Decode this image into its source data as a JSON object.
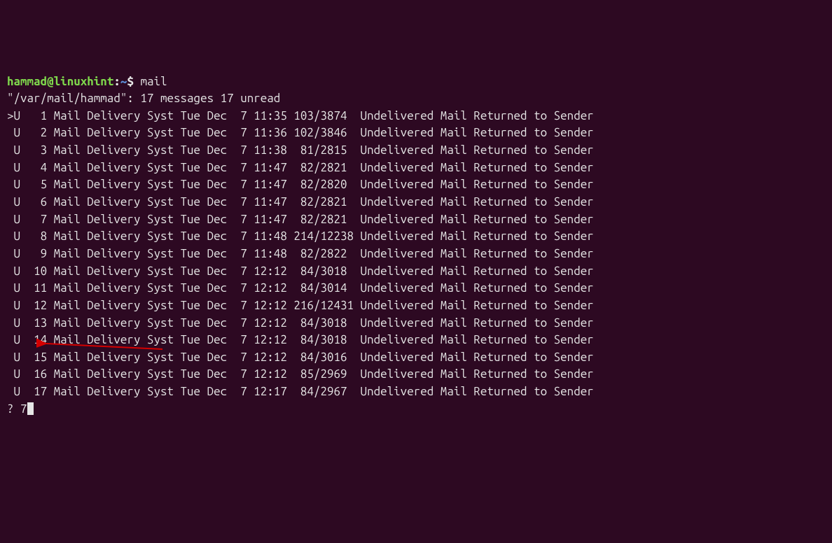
{
  "prompt": {
    "user": "hammad",
    "at": "@",
    "host": "linuxhint",
    "colon": ":",
    "tilde": "~",
    "dollar": "$",
    "command": "mail"
  },
  "header": "\"/var/mail/hammad\": 17 messages 17 unread",
  "messages": [
    {
      "cursor": ">",
      "flag": "U",
      "idx": " 1",
      "from": "Mail Delivery Syst",
      "date": "Tue Dec  7 11:35",
      "size": "103/3874 ",
      "subject": "Undelivered Mail Returned to Sender"
    },
    {
      "cursor": " ",
      "flag": "U",
      "idx": " 2",
      "from": "Mail Delivery Syst",
      "date": "Tue Dec  7 11:36",
      "size": "102/3846 ",
      "subject": "Undelivered Mail Returned to Sender"
    },
    {
      "cursor": " ",
      "flag": "U",
      "idx": " 3",
      "from": "Mail Delivery Syst",
      "date": "Tue Dec  7 11:38",
      "size": " 81/2815 ",
      "subject": "Undelivered Mail Returned to Sender"
    },
    {
      "cursor": " ",
      "flag": "U",
      "idx": " 4",
      "from": "Mail Delivery Syst",
      "date": "Tue Dec  7 11:47",
      "size": " 82/2821 ",
      "subject": "Undelivered Mail Returned to Sender"
    },
    {
      "cursor": " ",
      "flag": "U",
      "idx": " 5",
      "from": "Mail Delivery Syst",
      "date": "Tue Dec  7 11:47",
      "size": " 82/2820 ",
      "subject": "Undelivered Mail Returned to Sender"
    },
    {
      "cursor": " ",
      "flag": "U",
      "idx": " 6",
      "from": "Mail Delivery Syst",
      "date": "Tue Dec  7 11:47",
      "size": " 82/2821 ",
      "subject": "Undelivered Mail Returned to Sender"
    },
    {
      "cursor": " ",
      "flag": "U",
      "idx": " 7",
      "from": "Mail Delivery Syst",
      "date": "Tue Dec  7 11:47",
      "size": " 82/2821 ",
      "subject": "Undelivered Mail Returned to Sender"
    },
    {
      "cursor": " ",
      "flag": "U",
      "idx": " 8",
      "from": "Mail Delivery Syst",
      "date": "Tue Dec  7 11:48",
      "size": "214/12238",
      "subject": "Undelivered Mail Returned to Sender"
    },
    {
      "cursor": " ",
      "flag": "U",
      "idx": " 9",
      "from": "Mail Delivery Syst",
      "date": "Tue Dec  7 11:48",
      "size": " 82/2822 ",
      "subject": "Undelivered Mail Returned to Sender"
    },
    {
      "cursor": " ",
      "flag": "U",
      "idx": "10",
      "from": "Mail Delivery Syst",
      "date": "Tue Dec  7 12:12",
      "size": " 84/3018 ",
      "subject": "Undelivered Mail Returned to Sender"
    },
    {
      "cursor": " ",
      "flag": "U",
      "idx": "11",
      "from": "Mail Delivery Syst",
      "date": "Tue Dec  7 12:12",
      "size": " 84/3014 ",
      "subject": "Undelivered Mail Returned to Sender"
    },
    {
      "cursor": " ",
      "flag": "U",
      "idx": "12",
      "from": "Mail Delivery Syst",
      "date": "Tue Dec  7 12:12",
      "size": "216/12431",
      "subject": "Undelivered Mail Returned to Sender"
    },
    {
      "cursor": " ",
      "flag": "U",
      "idx": "13",
      "from": "Mail Delivery Syst",
      "date": "Tue Dec  7 12:12",
      "size": " 84/3018 ",
      "subject": "Undelivered Mail Returned to Sender"
    },
    {
      "cursor": " ",
      "flag": "U",
      "idx": "14",
      "from": "Mail Delivery Syst",
      "date": "Tue Dec  7 12:12",
      "size": " 84/3018 ",
      "subject": "Undelivered Mail Returned to Sender"
    },
    {
      "cursor": " ",
      "flag": "U",
      "idx": "15",
      "from": "Mail Delivery Syst",
      "date": "Tue Dec  7 12:12",
      "size": " 84/3016 ",
      "subject": "Undelivered Mail Returned to Sender"
    },
    {
      "cursor": " ",
      "flag": "U",
      "idx": "16",
      "from": "Mail Delivery Syst",
      "date": "Tue Dec  7 12:12",
      "size": " 85/2969 ",
      "subject": "Undelivered Mail Returned to Sender"
    },
    {
      "cursor": " ",
      "flag": "U",
      "idx": "17",
      "from": "Mail Delivery Syst",
      "date": "Tue Dec  7 12:17",
      "size": " 84/2967 ",
      "subject": "Undelivered Mail Returned to Sender"
    }
  ],
  "input": {
    "prompt": "? ",
    "value": "7"
  }
}
